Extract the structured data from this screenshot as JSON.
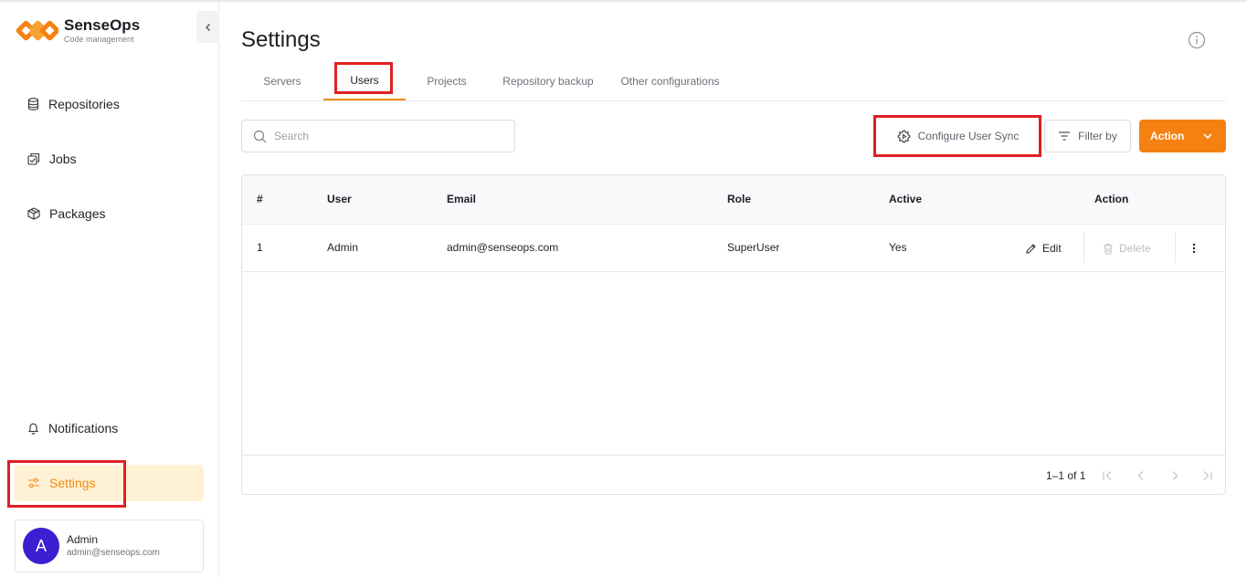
{
  "brand": {
    "name": "SenseOps",
    "subtitle": "Code management"
  },
  "sidebar": {
    "items": [
      {
        "label": "Repositories",
        "icon": "database-icon"
      },
      {
        "label": "Jobs",
        "icon": "jobs-icon"
      },
      {
        "label": "Packages",
        "icon": "package-icon"
      },
      {
        "label": "Notifications",
        "icon": "bell-icon"
      },
      {
        "label": "Settings",
        "icon": "sliders-icon",
        "active": true
      }
    ],
    "user": {
      "initial": "A",
      "name": "Admin",
      "email": "admin@senseops.com"
    }
  },
  "page": {
    "title": "Settings"
  },
  "tabs": [
    {
      "label": "Servers"
    },
    {
      "label": "Users",
      "active": true
    },
    {
      "label": "Projects"
    },
    {
      "label": "Repository backup"
    },
    {
      "label": "Other configurations"
    }
  ],
  "toolbar": {
    "search_placeholder": "Search",
    "configure_sync_label": "Configure User Sync",
    "filter_label": "Filter by",
    "action_label": "Action"
  },
  "table": {
    "columns": [
      "#",
      "User",
      "Email",
      "Role",
      "Active",
      "Action"
    ],
    "rows": [
      {
        "index": "1",
        "user": "Admin",
        "email": "admin@senseops.com",
        "role": "SuperUser",
        "active": "Yes",
        "edit": "Edit",
        "delete": "Delete"
      }
    ],
    "pagination": "1–1 of 1"
  },
  "colors": {
    "accent": "#f58112",
    "active_bg": "#fff1d6",
    "avatar": "#3b1fd1",
    "highlight": "#e02020"
  }
}
